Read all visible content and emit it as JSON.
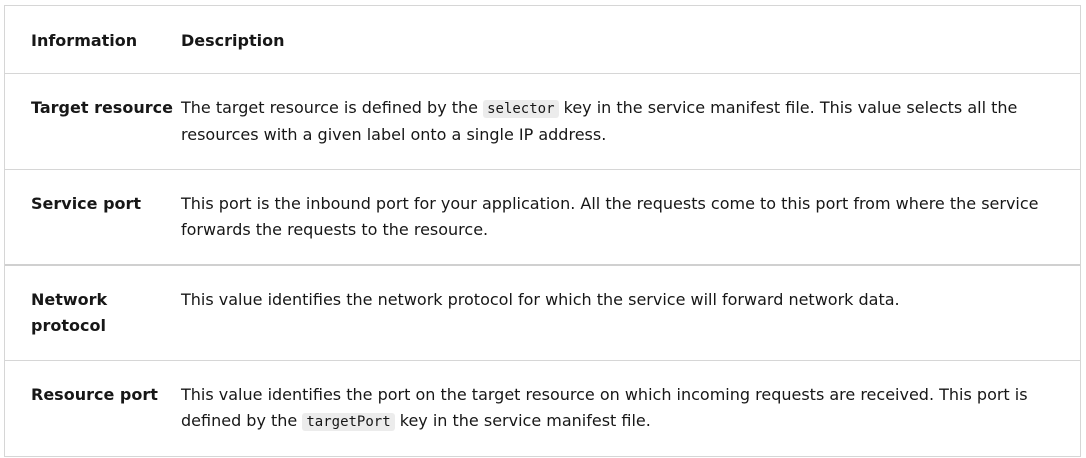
{
  "table": {
    "headers": {
      "information": "Information",
      "description": "Description"
    },
    "rows": [
      {
        "information": "Target resource",
        "description": {
          "before": "The target resource is defined by the ",
          "code": "selector",
          "after": " key in the service manifest file. This value selects all the resources with a given label onto a single IP address."
        }
      },
      {
        "information": "Service port",
        "description": {
          "before": "This port is the inbound port for your application. All the requests come to this port from where the service forwards the requests to the resource.",
          "code": "",
          "after": ""
        }
      },
      {
        "information": "Network protocol",
        "description": {
          "before": "This value identifies the network protocol for which the service will forward network data.",
          "code": "",
          "after": ""
        }
      },
      {
        "information": "Resource port",
        "description": {
          "before": "This value identifies the port on the target resource on which incoming requests are received. This port is defined by the ",
          "code": "targetPort",
          "after": " key in the service manifest file."
        }
      }
    ]
  }
}
